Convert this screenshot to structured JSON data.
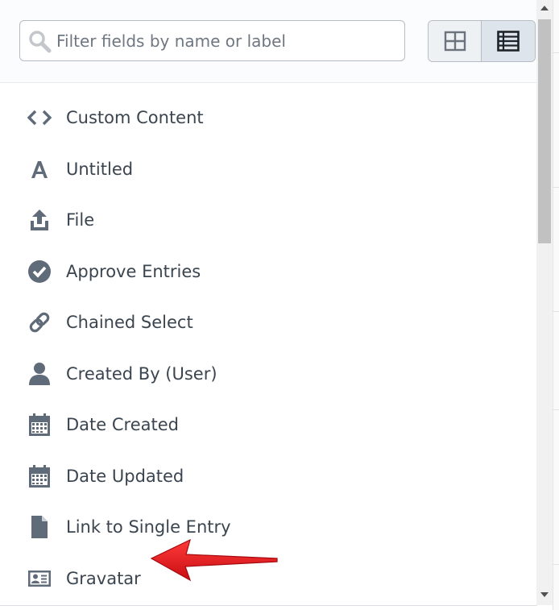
{
  "search": {
    "placeholder": "Filter fields by name or label",
    "value": ""
  },
  "view_toggle": {
    "selected": "list"
  },
  "fields": [
    {
      "label": "Custom Content",
      "icon": "code-icon"
    },
    {
      "label": "Untitled",
      "icon": "text-icon"
    },
    {
      "label": "File",
      "icon": "upload-icon"
    },
    {
      "label": "Approve Entries",
      "icon": "check-circle-icon"
    },
    {
      "label": "Chained Select",
      "icon": "link-icon"
    },
    {
      "label": "Created By (User)",
      "icon": "user-icon"
    },
    {
      "label": "Date Created",
      "icon": "calendar-icon"
    },
    {
      "label": "Date Updated",
      "icon": "calendar-icon"
    },
    {
      "label": "Link to Single Entry",
      "icon": "document-icon"
    },
    {
      "label": "Gravatar",
      "icon": "id-card-icon"
    }
  ],
  "colors": {
    "icon": "#5f6b78",
    "text": "#3a4550",
    "arrow": "#e8141b"
  }
}
